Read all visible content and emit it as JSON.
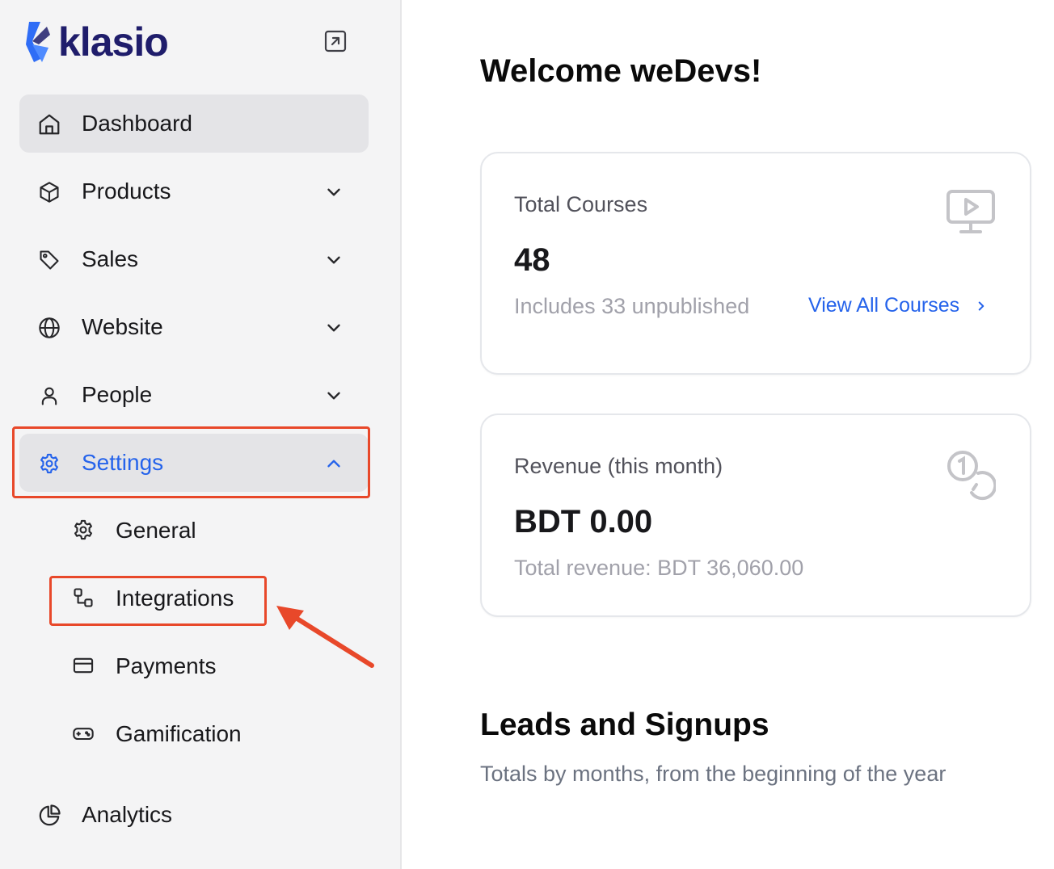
{
  "brand": {
    "name": "klasio",
    "color": "#1f1d6b",
    "accent": "#2f6df6"
  },
  "sidebar": {
    "items": [
      {
        "label": "Dashboard",
        "icon": "home-icon",
        "active": true
      },
      {
        "label": "Products",
        "icon": "box-icon"
      },
      {
        "label": "Sales",
        "icon": "tag-icon"
      },
      {
        "label": "Website",
        "icon": "globe-icon"
      },
      {
        "label": "People",
        "icon": "user-icon"
      },
      {
        "label": "Settings",
        "icon": "gear-icon",
        "expanded": true
      },
      {
        "label": "Analytics",
        "icon": "pie-chart-icon"
      }
    ],
    "settings_sub": [
      {
        "label": "General",
        "icon": "gear-icon"
      },
      {
        "label": "Integrations",
        "icon": "integrations-icon"
      },
      {
        "label": "Payments",
        "icon": "credit-card-icon"
      },
      {
        "label": "Gamification",
        "icon": "gamepad-icon"
      }
    ]
  },
  "main": {
    "welcome": "Welcome weDevs!",
    "cards": [
      {
        "title": "Total Courses",
        "value": "48",
        "note": "Includes 33 unpublished",
        "link": "View All Courses",
        "icon": "monitor-play-icon"
      },
      {
        "title": "Revenue (this month)",
        "value": "BDT 0.00",
        "note": "Total revenue: BDT 36,060.00",
        "icon": "coins-icon"
      }
    ],
    "section": {
      "title": "Leads and Signups",
      "subtitle": "Totals by months, from the beginning of the year"
    }
  },
  "colors": {
    "active_blue": "#2563eb",
    "highlight_red": "#e8482a"
  }
}
